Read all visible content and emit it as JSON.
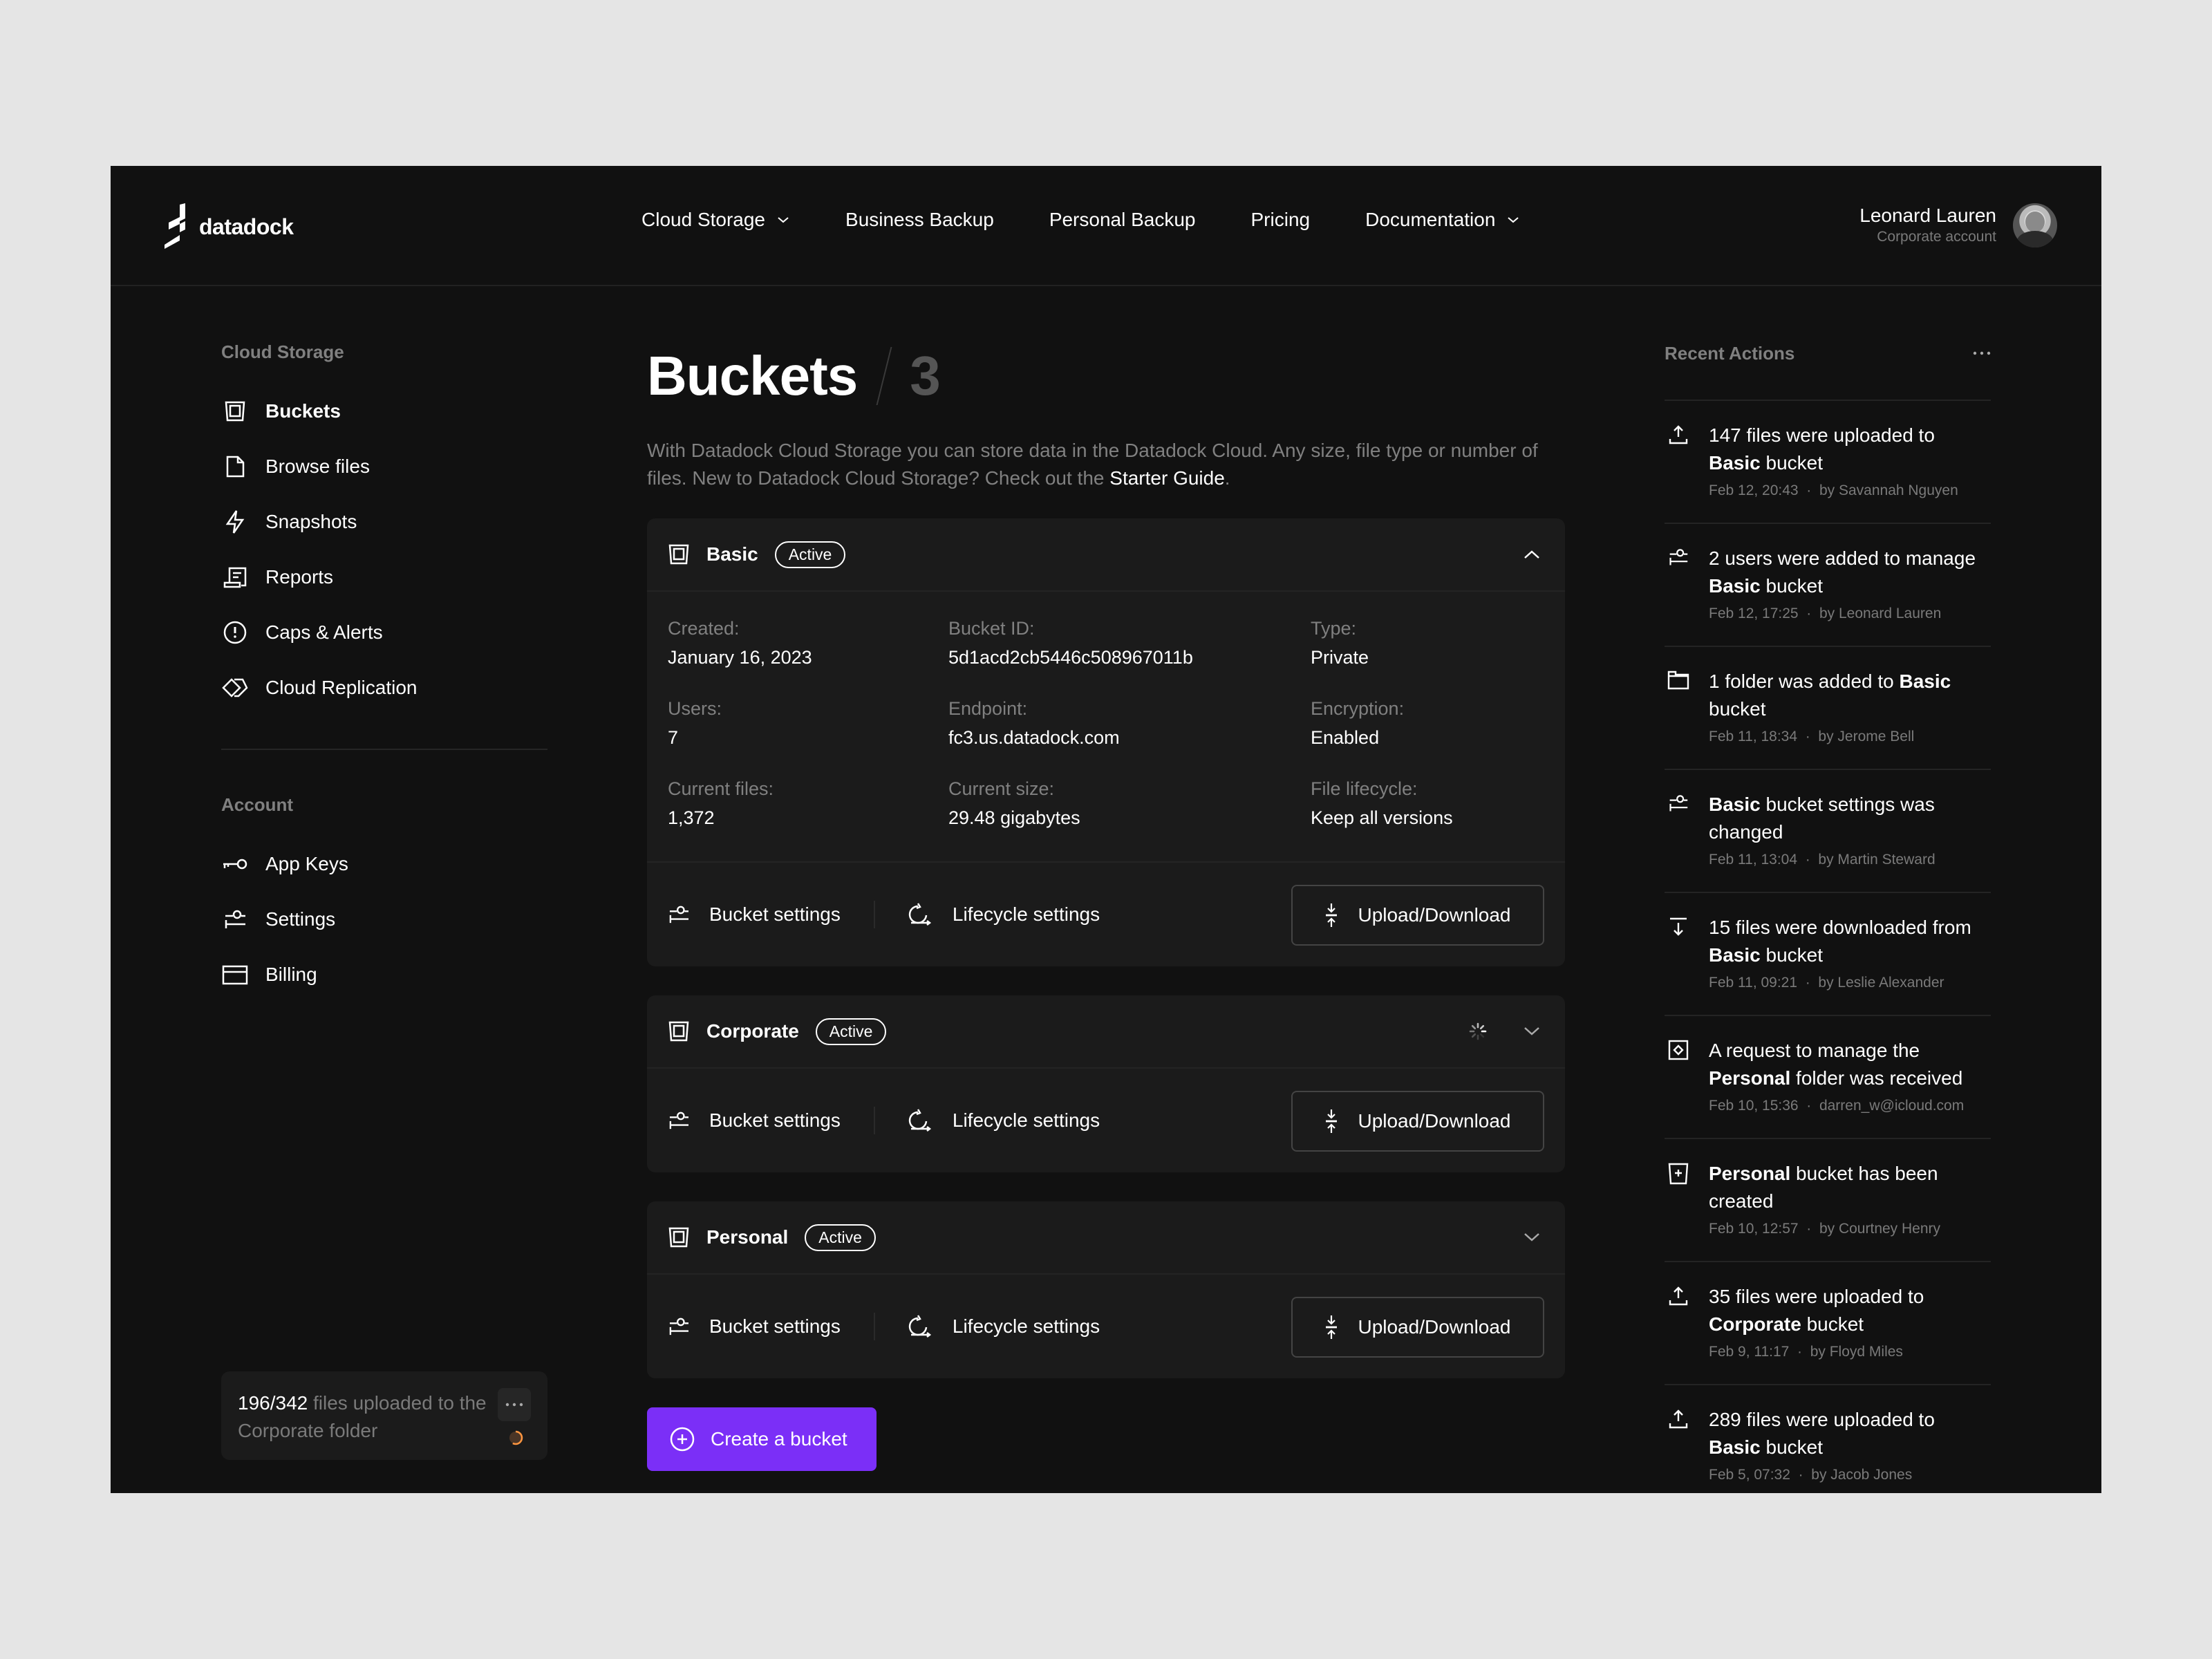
{
  "brand": {
    "name": "datadock"
  },
  "nav": {
    "items": [
      {
        "label": "Cloud Storage",
        "has_dropdown": true
      },
      {
        "label": "Business Backup",
        "has_dropdown": false
      },
      {
        "label": "Personal Backup",
        "has_dropdown": false
      },
      {
        "label": "Pricing",
        "has_dropdown": false
      },
      {
        "label": "Documentation",
        "has_dropdown": true
      }
    ]
  },
  "user": {
    "name": "Leonard Lauren",
    "account_type": "Corporate account"
  },
  "sidebar": {
    "sections": [
      {
        "title": "Cloud Storage",
        "items": [
          {
            "label": "Buckets",
            "icon": "bucket-icon",
            "active": true
          },
          {
            "label": "Browse files",
            "icon": "file-icon"
          },
          {
            "label": "Snapshots",
            "icon": "lightning-icon"
          },
          {
            "label": "Reports",
            "icon": "report-icon"
          },
          {
            "label": "Caps & Alerts",
            "icon": "alert-circle-icon"
          },
          {
            "label": "Cloud Replication",
            "icon": "replication-icon"
          }
        ]
      },
      {
        "title": "Account",
        "items": [
          {
            "label": "App Keys",
            "icon": "key-icon"
          },
          {
            "label": "Settings",
            "icon": "sliders-icon"
          },
          {
            "label": "Billing",
            "icon": "card-icon"
          }
        ]
      }
    ],
    "upload_status": {
      "progress_count": "196/342",
      "text": " files uploaded to the Corporate folder",
      "done": 196,
      "total": 342
    }
  },
  "main": {
    "title": "Buckets",
    "count": "3",
    "description": "With Datadock Cloud Storage you can store data in the Datadock Cloud. Any size, file type or number of files. New to Datadock Cloud Storage? Check out the ",
    "description_link": "Starter Guide",
    "description_end": ".",
    "buckets": [
      {
        "name": "Basic",
        "status": "Active",
        "expanded": true,
        "indicator": "orange-dot",
        "details": [
          {
            "label": "Created:",
            "value": "January 16, 2023"
          },
          {
            "label": "Bucket ID:",
            "value": "5d1acd2cb5446c508967011b"
          },
          {
            "label": "Type:",
            "value": "Private"
          },
          {
            "label": "Users:",
            "value": "7"
          },
          {
            "label": "Endpoint:",
            "value": "fc3.us.datadock.com"
          },
          {
            "label": "Encryption:",
            "value": "Enabled"
          },
          {
            "label": "Current files:",
            "value": "1,372"
          },
          {
            "label": "Current size:",
            "value": "29.48 gigabytes"
          },
          {
            "label": "File lifecycle:",
            "value": "Keep all versions"
          }
        ]
      },
      {
        "name": "Corporate",
        "status": "Active",
        "expanded": false,
        "indicator": "spinner"
      },
      {
        "name": "Personal",
        "status": "Active",
        "expanded": false,
        "indicator": "none"
      }
    ],
    "actions": {
      "bucket_settings": "Bucket settings",
      "lifecycle_settings": "Lifecycle settings",
      "upload_download": "Upload/Download"
    },
    "create_button": "Create a bucket"
  },
  "recent_actions": {
    "title": "Recent Actions",
    "items": [
      {
        "icon": "upload-icon",
        "pre": "147 files were uploaded to ",
        "bold": "Basic",
        "post": " bucket",
        "time": "Feb 12, 20:43",
        "by": "by  Savannah Nguyen"
      },
      {
        "icon": "sliders-icon",
        "pre": "2 users were added to manage ",
        "bold": "Basic",
        "post": " bucket",
        "time": "Feb 12, 17:25",
        "by": "by  Leonard Lauren"
      },
      {
        "icon": "folder-icon",
        "pre": "1 folder was added to ",
        "bold": "Basic",
        "post": " bucket",
        "time": "Feb 11, 18:34",
        "by": "by  Jerome Bell"
      },
      {
        "icon": "sliders-icon",
        "pre": "",
        "bold": "Basic",
        "post": " bucket settings was changed",
        "time": "Feb 11, 13:04",
        "by": "by  Martin Steward"
      },
      {
        "icon": "download-icon",
        "pre": "15 files were downloaded from ",
        "bold": "Basic",
        "post": " bucket",
        "time": "Feb 11, 09:21",
        "by": "by  Leslie Alexander"
      },
      {
        "icon": "request-icon",
        "pre": "A request to manage the ",
        "bold": "Personal",
        "post": " folder was received",
        "time": "Feb 10, 15:36",
        "by": "darren_w@icloud.com"
      },
      {
        "icon": "bucket-add-icon",
        "pre": "",
        "bold": "Personal",
        "post": " bucket has been created",
        "time": "Feb 10, 12:57",
        "by": "by  Courtney Henry"
      },
      {
        "icon": "upload-icon",
        "pre": "35 files were uploaded to ",
        "bold": "Corporate",
        "post": " bucket",
        "time": "Feb 9, 11:17",
        "by": "by  Floyd Miles"
      },
      {
        "icon": "upload-icon",
        "pre": "289 files were uploaded to ",
        "bold": "Basic",
        "post": " bucket",
        "time": "Feb 5, 07:32",
        "by": "by  Jacob Jones"
      }
    ]
  },
  "colors": {
    "accent": "#7b2ff7",
    "background": "#111111",
    "card": "#1b1b1b",
    "page_outer": "#e5e5e5",
    "warning_dot": "#ff9640",
    "muted_text": "#808080"
  }
}
